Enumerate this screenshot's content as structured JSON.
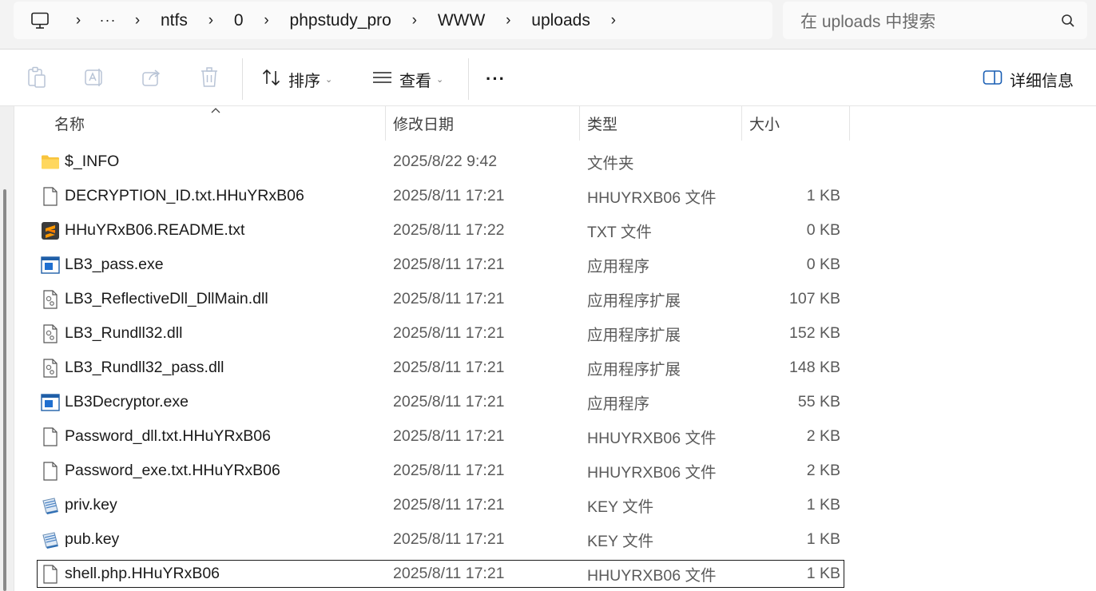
{
  "address_bar": {
    "more_label": "···",
    "crumbs": [
      "ntfs",
      "0",
      "phpstudy_pro",
      "WWW",
      "uploads"
    ]
  },
  "search": {
    "placeholder": "在 uploads 中搜索"
  },
  "toolbar": {
    "sort_label": "排序",
    "view_label": "查看",
    "more_label": "···",
    "details_label": "详细信息"
  },
  "columns": {
    "name": "名称",
    "date": "修改日期",
    "type": "类型",
    "size": "大小"
  },
  "files": [
    {
      "name": "$_INFO",
      "date": "2025/8/22 9:42",
      "type": "文件夹",
      "size": "",
      "icon": "folder-icon"
    },
    {
      "name": "DECRYPTION_ID.txt.HHuYRxB06",
      "date": "2025/8/11 17:21",
      "type": "HHUYRXB06 文件",
      "size": "1 KB",
      "icon": "file-icon"
    },
    {
      "name": "HHuYRxB06.README.txt",
      "date": "2025/8/11 17:22",
      "type": "TXT 文件",
      "size": "0 KB",
      "icon": "sublime-text-icon"
    },
    {
      "name": "LB3_pass.exe",
      "date": "2025/8/11 17:21",
      "type": "应用程序",
      "size": "0 KB",
      "icon": "exe-icon"
    },
    {
      "name": "LB3_ReflectiveDll_DllMain.dll",
      "date": "2025/8/11 17:21",
      "type": "应用程序扩展",
      "size": "107 KB",
      "icon": "dll-icon"
    },
    {
      "name": "LB3_Rundll32.dll",
      "date": "2025/8/11 17:21",
      "type": "应用程序扩展",
      "size": "152 KB",
      "icon": "dll-icon"
    },
    {
      "name": "LB3_Rundll32_pass.dll",
      "date": "2025/8/11 17:21",
      "type": "应用程序扩展",
      "size": "148 KB",
      "icon": "dll-icon"
    },
    {
      "name": "LB3Decryptor.exe",
      "date": "2025/8/11 17:21",
      "type": "应用程序",
      "size": "55 KB",
      "icon": "exe-icon"
    },
    {
      "name": "Password_dll.txt.HHuYRxB06",
      "date": "2025/8/11 17:21",
      "type": "HHUYRXB06 文件",
      "size": "2 KB",
      "icon": "file-icon"
    },
    {
      "name": "Password_exe.txt.HHuYRxB06",
      "date": "2025/8/11 17:21",
      "type": "HHUYRXB06 文件",
      "size": "2 KB",
      "icon": "file-icon"
    },
    {
      "name": "priv.key",
      "date": "2025/8/11 17:21",
      "type": "KEY 文件",
      "size": "1 KB",
      "icon": "key-file-icon"
    },
    {
      "name": "pub.key",
      "date": "2025/8/11 17:21",
      "type": "KEY 文件",
      "size": "1 KB",
      "icon": "key-file-icon"
    },
    {
      "name": "shell.php.HHuYRxB06",
      "date": "2025/8/11 17:21",
      "type": "HHUYRXB06 文件",
      "size": "1 KB",
      "icon": "file-icon",
      "selected": true
    }
  ]
}
